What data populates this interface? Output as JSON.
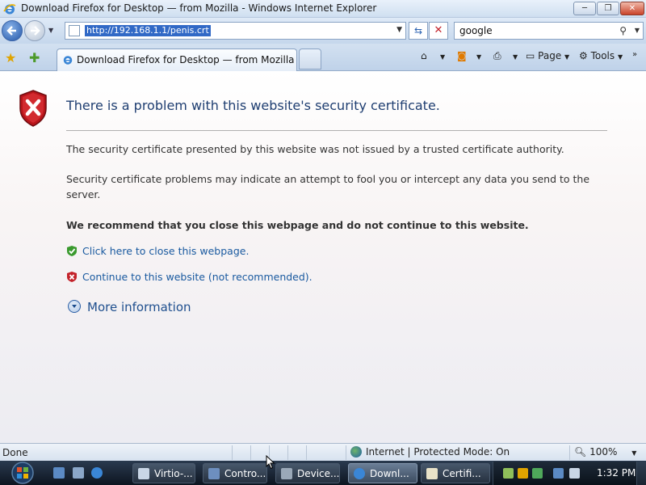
{
  "window": {
    "title": "Download Firefox for Desktop — from Mozilla - Windows Internet Explorer",
    "minimize_label": "─",
    "maximize_label": "❐",
    "close_label": "✕"
  },
  "addressbar": {
    "url": "http://192.168.1.1/penis.crt",
    "search_value": "google"
  },
  "tabs": [
    {
      "label": "Download Firefox for Desktop — from Mozilla"
    }
  ],
  "toolbar": {
    "page_label": "Page",
    "tools_label": "Tools"
  },
  "content": {
    "heading": "There is a problem with this website's security certificate.",
    "para1": "The security certificate presented by this website was not issued by a trusted certificate authority.",
    "para2": "Security certificate problems may indicate an attempt to fool you or intercept any data you send to the server.",
    "recommend": "We recommend that you close this webpage and do not continue to this website.",
    "close_link": "Click here to close this webpage.",
    "continue_link": "Continue to this website (not recommended).",
    "more_info": "More information"
  },
  "statusbar": {
    "status": "Done",
    "zone": "Internet | Protected Mode: On",
    "zoom": "100%"
  },
  "taskbar": {
    "buttons": [
      {
        "label": "Virtio-..."
      },
      {
        "label": "Contro..."
      },
      {
        "label": "Device..."
      },
      {
        "label": "Downl..."
      },
      {
        "label": "Certifi..."
      }
    ],
    "clock": "1:32 PM"
  },
  "colors": {
    "link": "#1a5aa0",
    "heading": "#1f3e71",
    "url_highlight": "#3169c6",
    "error_red": "#c3222a",
    "safe_green": "#3a9a2e"
  }
}
